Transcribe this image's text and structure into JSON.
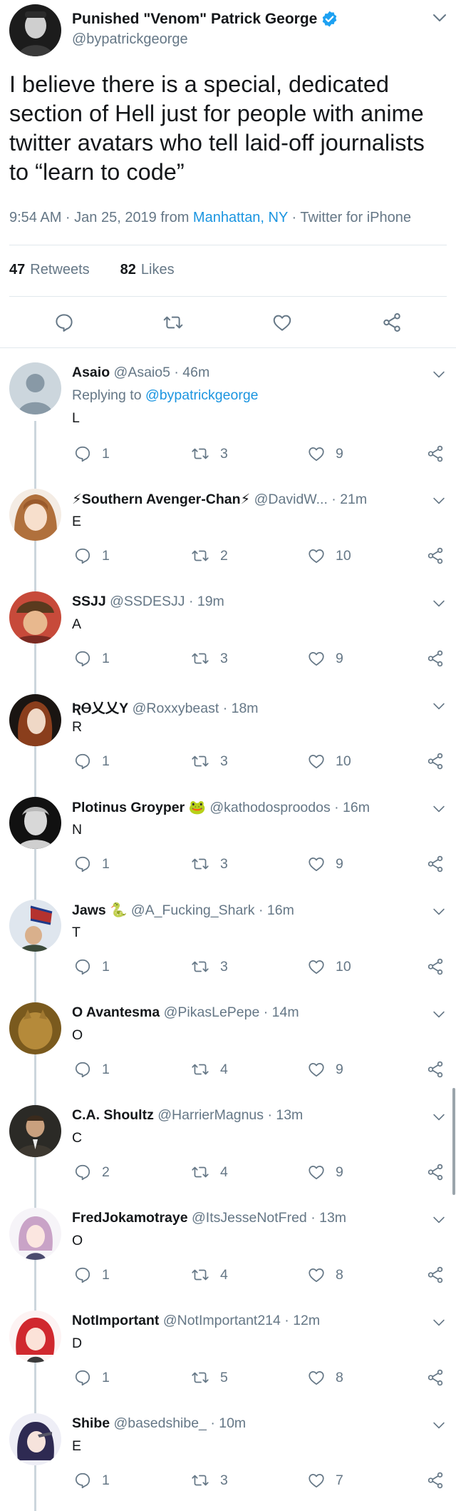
{
  "main_tweet": {
    "author_name": "Punished \"Venom\" Patrick George",
    "handle": "@bypatrickgeorge",
    "text": "I believe there is a special, dedicated section of Hell just for people with anime twitter avatars who tell laid-off journalists to “learn to code”",
    "time": "9:54 AM · Jan 25, 2019 from ",
    "location": "Manhattan, NY",
    "source": " · Twitter for iPhone",
    "retweets_count": "47",
    "retweets_label": "Retweets",
    "likes_count": "82",
    "likes_label": "Likes"
  },
  "replies": [
    {
      "name": "Asaio",
      "handle": "@Asaio5",
      "time": "· 46m",
      "replying_label": "Replying to ",
      "replying_to": "@bypatrickgeorge",
      "text": "L",
      "comments": "1",
      "retweets": "3",
      "likes": "9"
    },
    {
      "name": "⚡Southern Avenger-Chan⚡",
      "handle": "@DavidW...",
      "time": "· 21m",
      "text": "E",
      "comments": "1",
      "retweets": "2",
      "likes": "10"
    },
    {
      "name": "SSJJ",
      "handle": "@SSDESJJ",
      "time": "· 19m",
      "text": "A",
      "comments": "1",
      "retweets": "3",
      "likes": "9"
    },
    {
      "name": "ƦⲐ乂乂Y",
      "handle": "@Roxxybeast",
      "time": "· 18m",
      "text": "R",
      "comments": "1",
      "retweets": "3",
      "likes": "10"
    },
    {
      "name": "Plotinus Groyper 🐸",
      "handle": "@kathodosproodos",
      "time": "· 16m",
      "text": "N",
      "comments": "1",
      "retweets": "3",
      "likes": "9"
    },
    {
      "name": "Jaws 🐍",
      "handle": "@A_Fucking_Shark",
      "time": "· 16m",
      "text": "T",
      "comments": "1",
      "retweets": "3",
      "likes": "10"
    },
    {
      "name": "O Avantesma",
      "handle": "@PikasLePepe",
      "time": "· 14m",
      "text": "O",
      "comments": "1",
      "retweets": "4",
      "likes": "9"
    },
    {
      "name": "C.A. Shoultz",
      "handle": "@HarrierMagnus",
      "time": "· 13m",
      "text": "C",
      "comments": "2",
      "retweets": "4",
      "likes": "9"
    },
    {
      "name": "FredJokamotraye",
      "handle": "@ItsJesseNotFred",
      "time": "· 13m",
      "text": "O",
      "comments": "1",
      "retweets": "4",
      "likes": "8"
    },
    {
      "name": "NotImportant",
      "handle": "@NotImportant214",
      "time": "· 12m",
      "text": "D",
      "comments": "1",
      "retweets": "5",
      "likes": "8"
    },
    {
      "name": "Shibe",
      "handle": "@basedshibe_",
      "time": "· 10m",
      "text": "E",
      "comments": "1",
      "retweets": "3",
      "likes": "7"
    }
  ],
  "colors": {
    "link": "#1b95e0",
    "verified": "#1da1f2",
    "secondary_text": "#657786",
    "divider": "#e1e8ed"
  },
  "icons": [
    "verified-badge-icon",
    "chevron-down-icon",
    "comment-icon",
    "retweet-icon",
    "like-icon",
    "share-icon"
  ]
}
